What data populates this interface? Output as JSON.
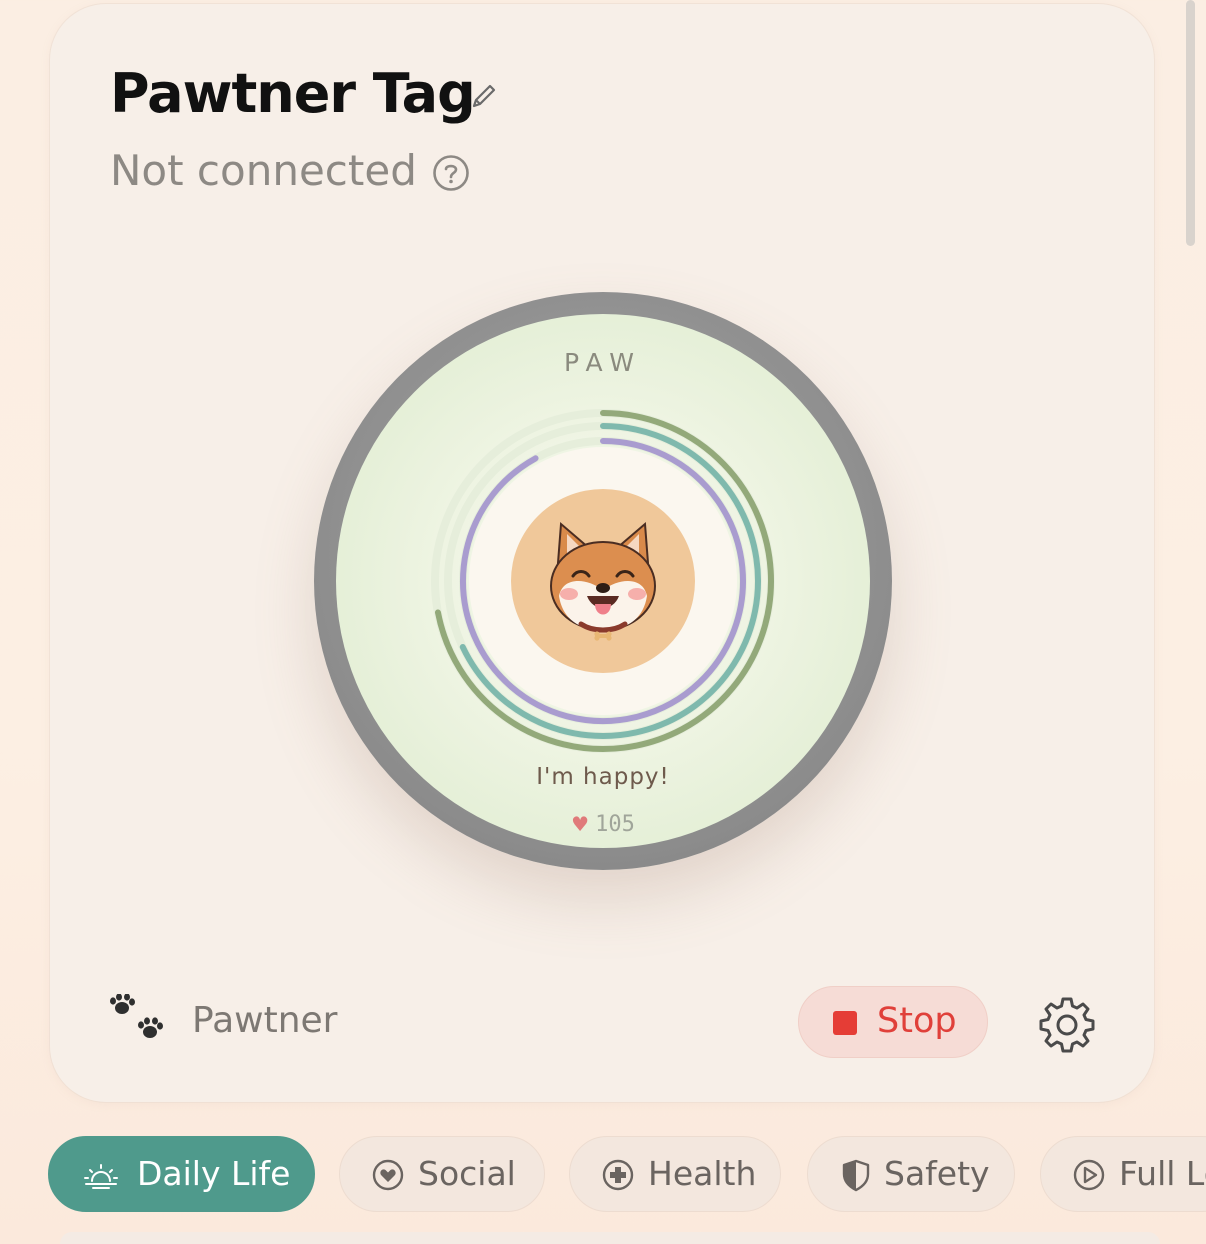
{
  "header": {
    "title": "Pawtner Tag",
    "status": "Not connected"
  },
  "device": {
    "brand": "PAW",
    "mood": "I'm happy!",
    "heart_rate": "105",
    "rings": [
      {
        "name": "outer",
        "color": "#93a97a",
        "progress": 0.72
      },
      {
        "name": "middle",
        "color": "#7fb9ad",
        "progress": 0.68
      },
      {
        "name": "inner",
        "color": "#a99ccf",
        "progress": 0.92
      }
    ],
    "face_color": "#e9f1de",
    "bezel_color": "#8f8f8f"
  },
  "footer": {
    "brand_label": "Pawtner",
    "stop_label": "Stop"
  },
  "tabs": [
    {
      "label": "Daily Life",
      "icon": "sunrise-icon",
      "active": true
    },
    {
      "label": "Social",
      "icon": "heart-circle-icon",
      "active": false
    },
    {
      "label": "Health",
      "icon": "plus-circle-icon",
      "active": false
    },
    {
      "label": "Safety",
      "icon": "shield-icon",
      "active": false
    },
    {
      "label": "Full Lo",
      "icon": "play-circle-icon",
      "active": false
    }
  ],
  "colors": {
    "accent": "#4f9a8c",
    "stop_red": "#e53d36",
    "background": "#fbeee3"
  }
}
